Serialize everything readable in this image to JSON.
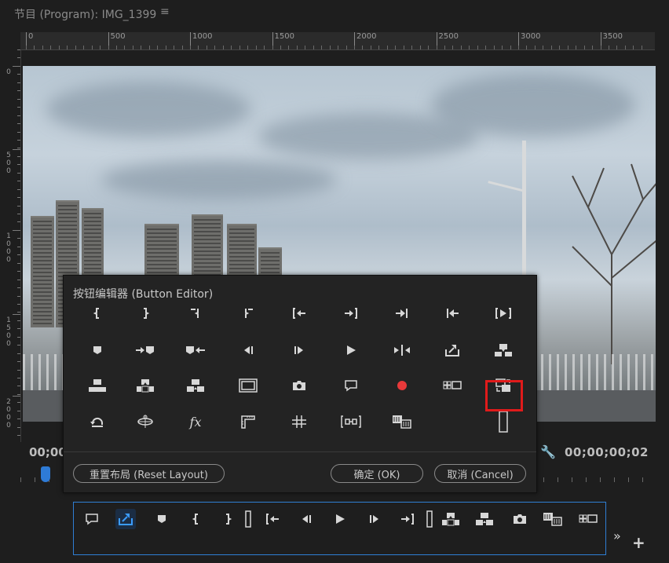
{
  "panel": {
    "title": "节目 (Program): IMG_1399",
    "menu_icon": "hamburger-icon"
  },
  "ruler": {
    "top_labels": [
      "0",
      "500",
      "1000",
      "1500",
      "2000",
      "2500",
      "3000",
      "3500"
    ],
    "left_labels": [
      "0",
      "5\n0\n0",
      "1\n0\n0\n0",
      "1\n5\n0\n0",
      "2\n0\n0\n0"
    ]
  },
  "timecode": {
    "current": "00;00",
    "duration": "00;00;00;02"
  },
  "dialog": {
    "title": "按钮编辑器 (Button Editor)",
    "reset_label": "重置布局 (Reset Layout)",
    "ok_label": "确定 (OK)",
    "cancel_label": "取消 (Cancel)",
    "highlighted_button": "toggle-proxies-icon",
    "rows": [
      [
        "mark-in-icon",
        "mark-out-icon",
        "clear-in-icon",
        "clear-out-icon",
        "go-to-in-icon",
        "go-to-out-icon",
        "go-to-next-edit-icon",
        "go-to-previous-edit-icon",
        "play-in-to-out-icon"
      ],
      [
        "add-marker-icon",
        "go-to-next-marker-icon",
        "go-to-previous-marker-icon",
        "step-back-icon",
        "step-forward-icon",
        "play-stop-icon",
        "shuttle-icon",
        "export-frame-icon",
        "insert-icon"
      ],
      [
        "overwrite-icon",
        "lift-icon",
        "extract-icon",
        "safe-margins-icon",
        "camera-icon",
        "comment-icon",
        "record-icon",
        "multi-camera-icon",
        "toggle-proxies-icon"
      ],
      [
        "loop-icon",
        "vr-video-icon",
        "fx-icon",
        "show-rulers-icon",
        "show-guides-icon",
        "snap-guides-icon",
        "trim-monitor-icon",
        "",
        "spacer-icon"
      ]
    ]
  },
  "toolbar": {
    "buttons": [
      "comment-icon",
      "export-frame-icon",
      "add-marker-icon",
      "mark-in-icon",
      "mark-out-icon",
      "spacer-icon",
      "go-to-in-icon",
      "step-back-icon",
      "play-stop-icon",
      "step-forward-icon",
      "go-to-out-icon",
      "spacer-icon",
      "lift-icon",
      "extract-icon",
      "camera-icon",
      "trim-monitor-icon",
      "multi-camera-icon"
    ],
    "overflow_icon": "chevron-double-right-icon",
    "add_icon": "plus-icon"
  },
  "colors": {
    "accent": "#2f7fd4",
    "highlight": "#e01b1b",
    "record": "#e8393a"
  }
}
